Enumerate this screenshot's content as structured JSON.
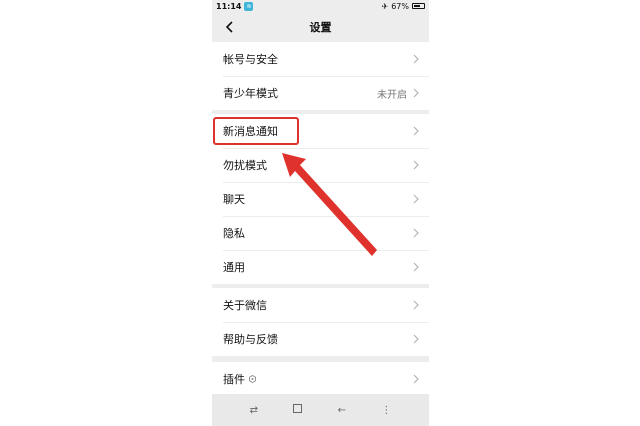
{
  "status": {
    "time": "11:14",
    "battery": "67%",
    "battery_level": 0.67,
    "airplane": "✈"
  },
  "header": {
    "title": "设置"
  },
  "groups": [
    {
      "items": [
        {
          "label": "帐号与安全",
          "value": ""
        },
        {
          "label": "青少年模式",
          "value": "未开启"
        }
      ]
    },
    {
      "items": [
        {
          "label": "新消息通知",
          "value": ""
        },
        {
          "label": "勿扰模式",
          "value": ""
        },
        {
          "label": "聊天",
          "value": ""
        },
        {
          "label": "隐私",
          "value": ""
        },
        {
          "label": "通用",
          "value": ""
        }
      ]
    },
    {
      "items": [
        {
          "label": "关于微信",
          "value": ""
        },
        {
          "label": "帮助与反馈",
          "value": ""
        }
      ]
    },
    {
      "items": [
        {
          "label": "插件",
          "value": ""
        }
      ]
    }
  ],
  "icons": {
    "back": "chevron-left-icon",
    "chevron": "chevron-right-icon",
    "plugin": "plugin-icon"
  },
  "colors": {
    "highlight": "#e0322c",
    "arrow": "#e0322c",
    "page_bg": "#ededed"
  }
}
